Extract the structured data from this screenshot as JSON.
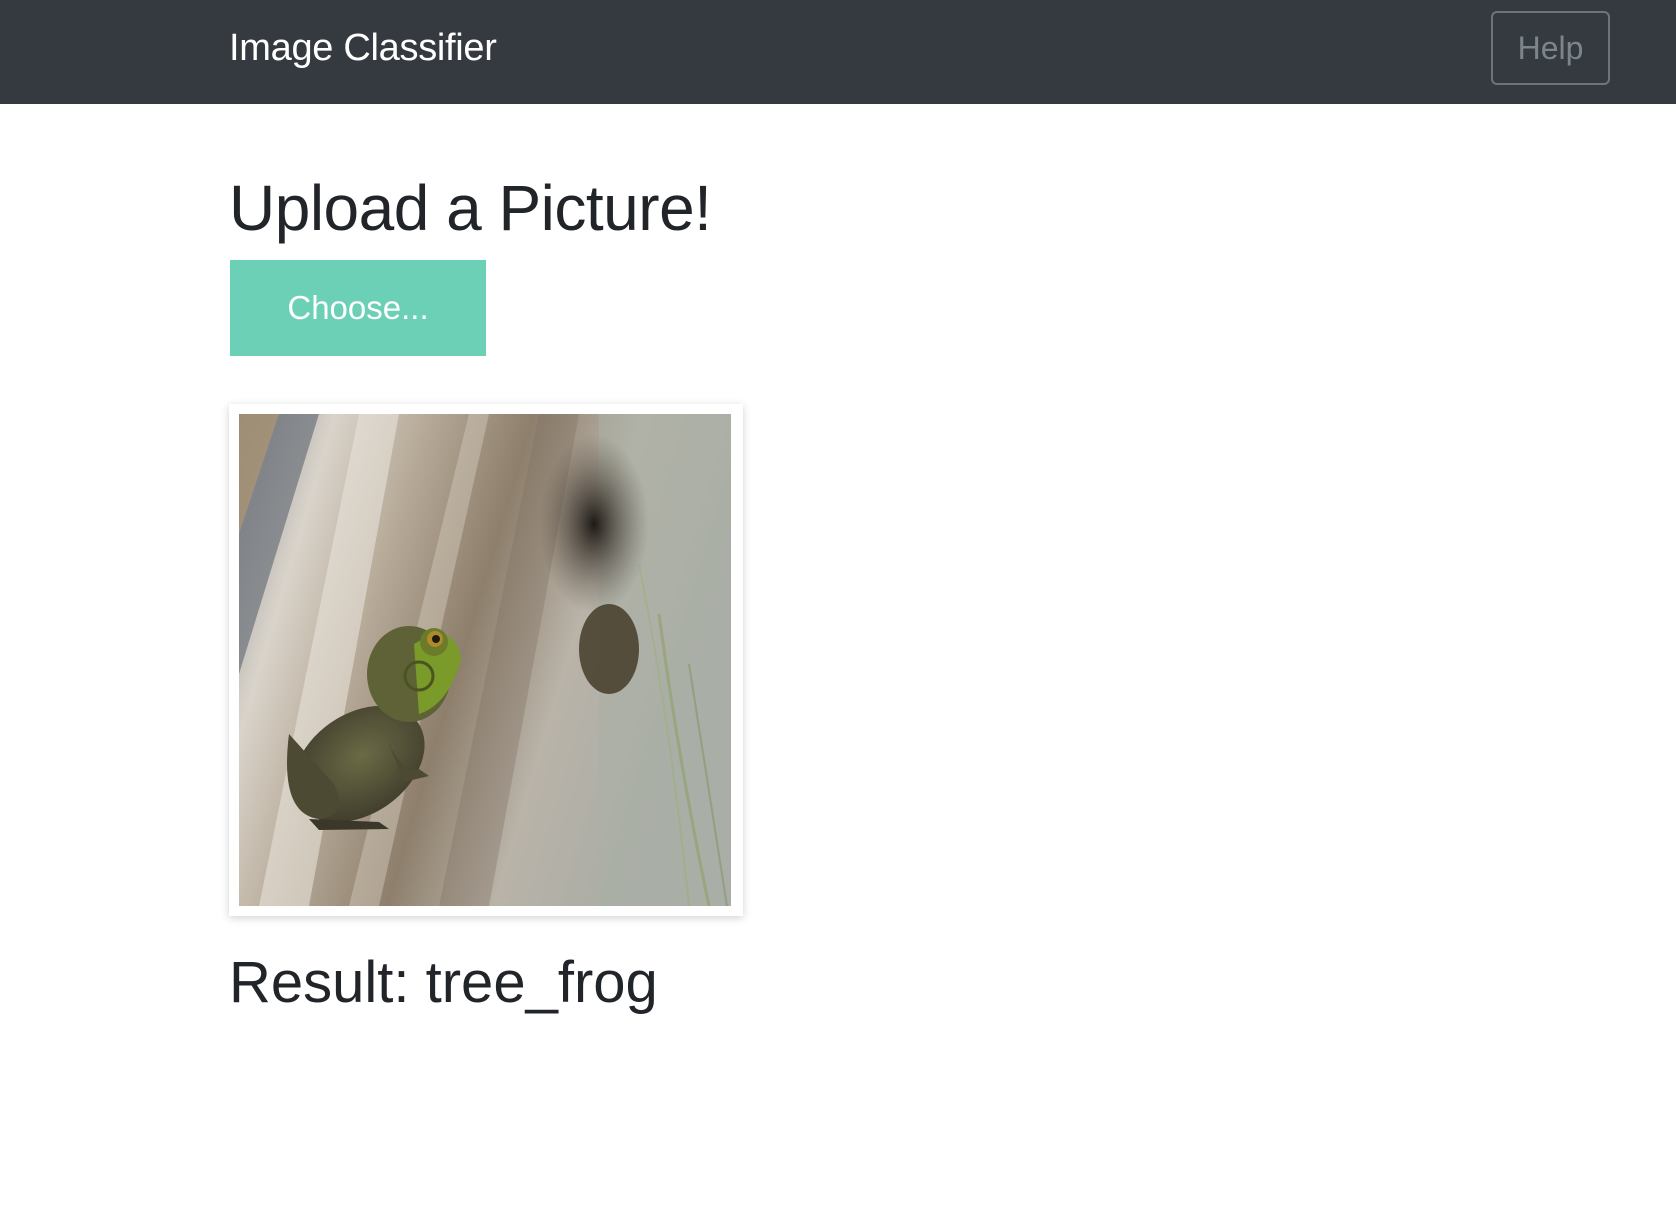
{
  "navbar": {
    "brand": "Image Classifier",
    "help_label": "Help"
  },
  "main": {
    "heading": "Upload a Picture!",
    "choose_label": "Choose...",
    "result_text": "Result: tree_frog"
  },
  "colors": {
    "navbar_bg": "#343a40",
    "choose_button": "#6bd0b5",
    "help_border": "#6c757d"
  }
}
